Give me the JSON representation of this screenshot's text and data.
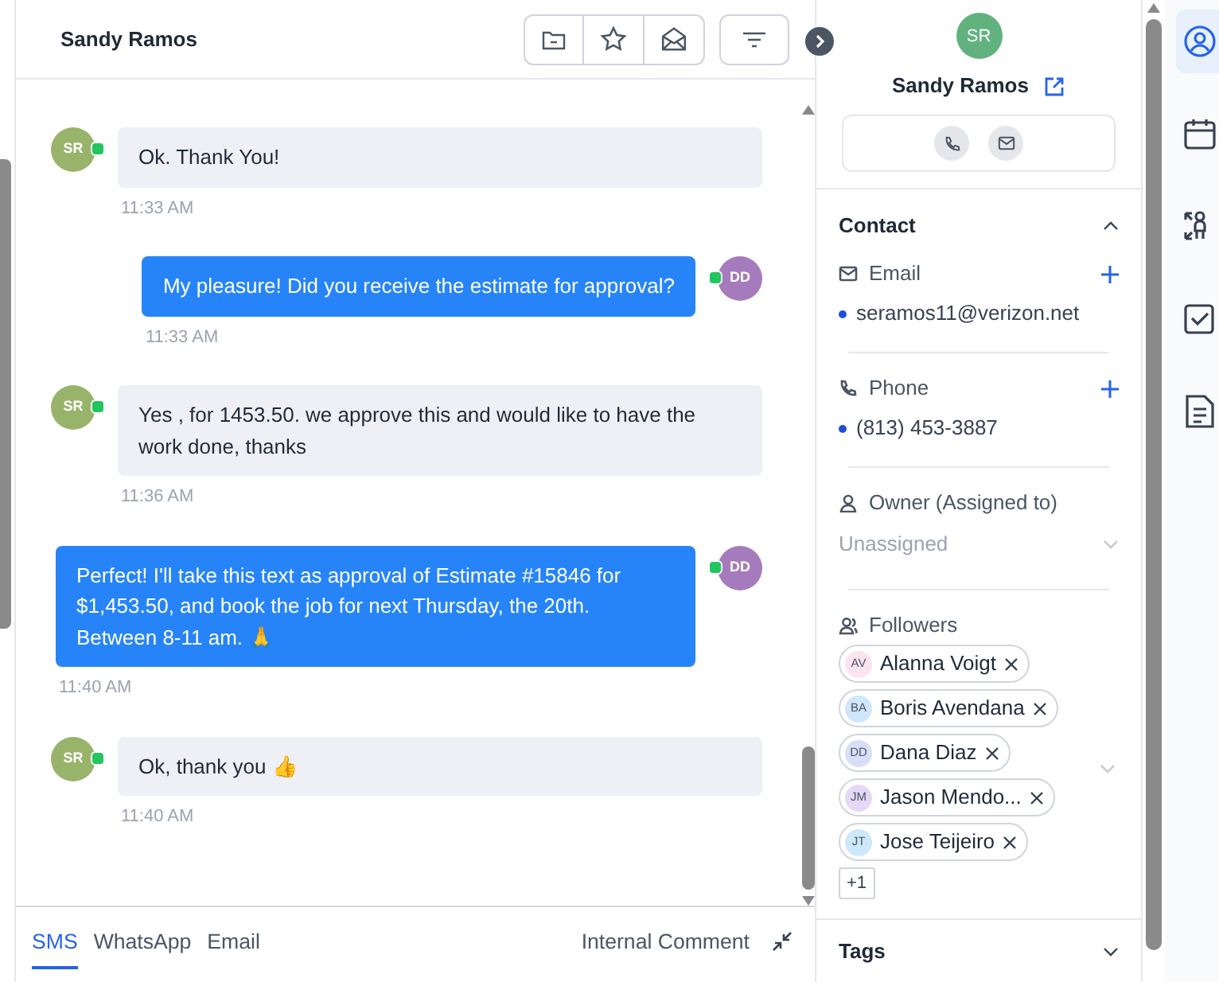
{
  "conversation": {
    "title": "Sandy Ramos"
  },
  "messages": [
    {
      "kind": "incoming",
      "initials": "SR",
      "text": "Ok. Thank You!",
      "time": "11:33 AM"
    },
    {
      "kind": "outgoing",
      "initials": "DD",
      "text": "My pleasure! Did you receive the estimate for approval?",
      "time": "11:33 AM"
    },
    {
      "kind": "incoming",
      "initials": "SR",
      "text": "Yes , for 1453.50. we approve this and would like to have the work done, thanks",
      "time": "11:36 AM"
    },
    {
      "kind": "outgoing",
      "initials": "DD",
      "text": "Perfect! I'll take this text as approval of Estimate #15846 for $1,453.50, and book the job for next Thursday, the 20th. Between 8-11 am.  🙏",
      "time": "11:40 AM"
    },
    {
      "kind": "incoming",
      "initials": "SR",
      "text": "Ok, thank you 👍",
      "time": "11:40 AM"
    }
  ],
  "composer": {
    "tabs": [
      {
        "label": "SMS",
        "selected": true
      },
      {
        "label": "WhatsApp",
        "selected": false
      },
      {
        "label": "Email",
        "selected": false
      }
    ],
    "internal_comment": "Internal Comment"
  },
  "profile": {
    "initials": "SR",
    "name": "Sandy Ramos"
  },
  "contact_section": {
    "title": "Contact",
    "expanded": true,
    "email_label": "Email",
    "emails": [
      "seramos11@verizon.net"
    ],
    "phone_label": "Phone",
    "phones": [
      "(813) 453-3887"
    ],
    "owner_label": "Owner (Assigned to)",
    "owner_placeholder": "Unassigned",
    "followers_label": "Followers",
    "followers": [
      {
        "initials": "AV",
        "name": "Alanna Voigt",
        "color": "#fbe4f0"
      },
      {
        "initials": "BA",
        "name": "Boris Avendana",
        "color": "#cfe6fb"
      },
      {
        "initials": "DD",
        "name": "Dana Diaz",
        "color": "#d9def8"
      },
      {
        "initials": "JM",
        "name": "Jason Mendo...",
        "color": "#e3d9f7"
      },
      {
        "initials": "JT",
        "name": "Jose Teijeiro",
        "color": "#cde7fb"
      }
    ],
    "more_followers": "+1"
  },
  "tags_section": {
    "title": "Tags",
    "expanded": false
  },
  "rail": [
    {
      "kind": "contact",
      "selected": true
    },
    {
      "kind": "calendar",
      "selected": false
    },
    {
      "kind": "hierarchy",
      "selected": false
    },
    {
      "kind": "tasks",
      "selected": false
    },
    {
      "kind": "notes",
      "selected": false
    }
  ]
}
